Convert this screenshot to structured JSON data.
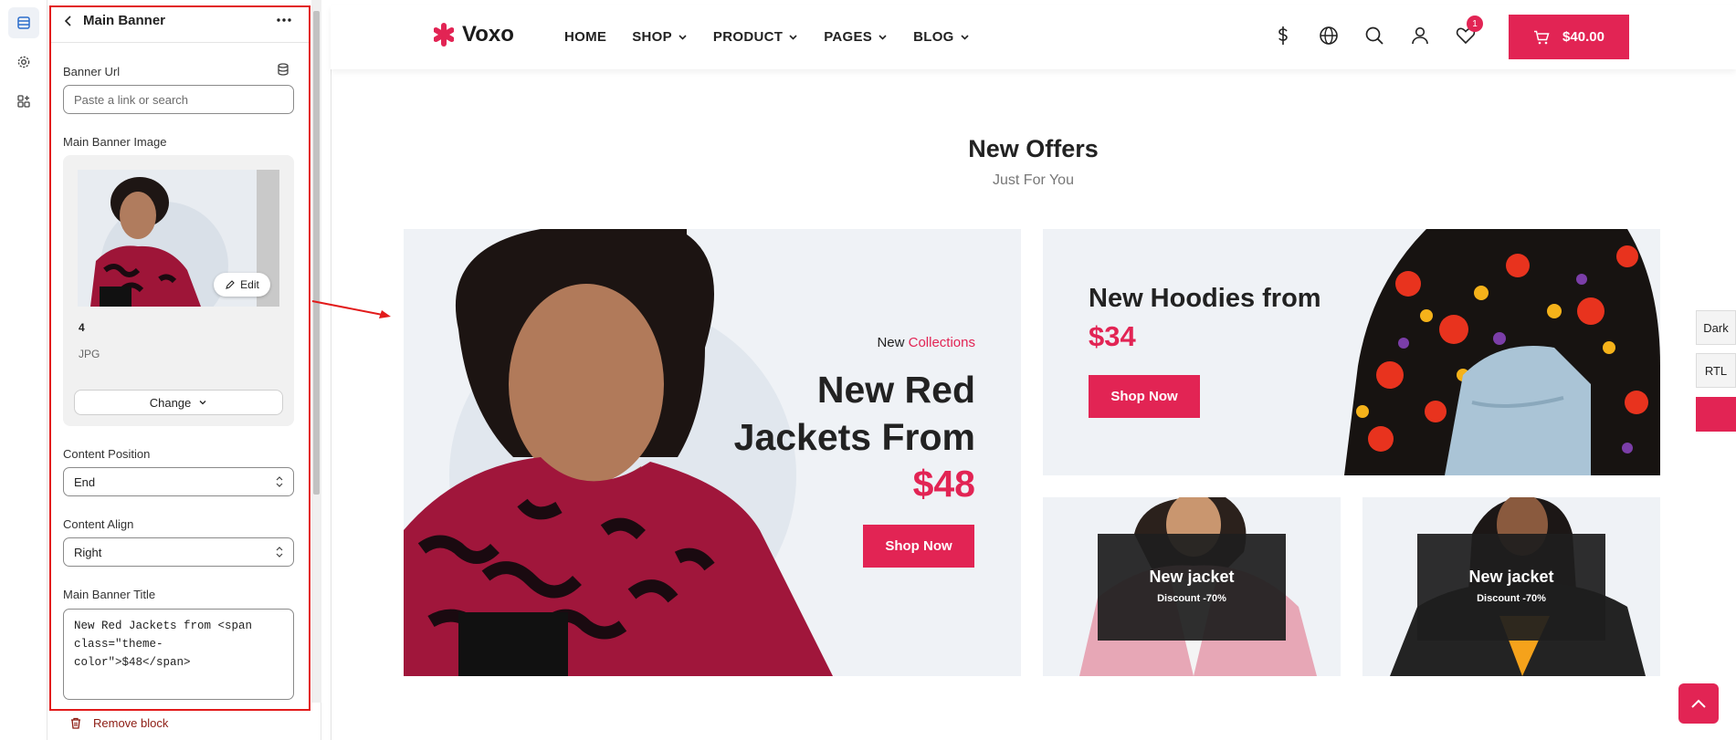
{
  "editor": {
    "panel_title": "Main Banner",
    "banner_url": {
      "label": "Banner Url",
      "placeholder": "Paste a link or search"
    },
    "image": {
      "label": "Main Banner Image",
      "edit_label": "Edit",
      "name": "4",
      "ext": "JPG",
      "change_label": "Change"
    },
    "content_position": {
      "label": "Content Position",
      "value": "End"
    },
    "content_align": {
      "label": "Content Align",
      "value": "Right"
    },
    "banner_title": {
      "label": "Main Banner Title",
      "value": "New Red Jackets from <span\nclass=\"theme-\ncolor\">$48</span>"
    },
    "remove_label": "Remove block"
  },
  "store": {
    "brand": "Voxo",
    "nav": [
      {
        "label": "HOME",
        "dropdown": false
      },
      {
        "label": "SHOP",
        "dropdown": true
      },
      {
        "label": "PRODUCT",
        "dropdown": true
      },
      {
        "label": "PAGES",
        "dropdown": true
      },
      {
        "label": "BLOG",
        "dropdown": true
      }
    ],
    "wishlist_count": "1",
    "cart_total": "$40.00",
    "accent_color": "#e22454"
  },
  "offers": {
    "title": "New Offers",
    "subtitle": "Just For You",
    "main_banner": {
      "kicker_plain": "New",
      "kicker_accent": "Collections",
      "title": "New Red Jackets From",
      "price": "$48",
      "button": "Shop Now"
    },
    "hoodies_banner": {
      "title": "New Hoodies from",
      "price": "$34",
      "button": "Shop Now"
    },
    "small_banners": [
      {
        "title": "New jacket",
        "subtitle": "Discount -70%"
      },
      {
        "title": "New jacket",
        "subtitle": "Discount -70%"
      }
    ]
  },
  "side_controls": {
    "dark": "Dark",
    "rtl": "RTL"
  }
}
